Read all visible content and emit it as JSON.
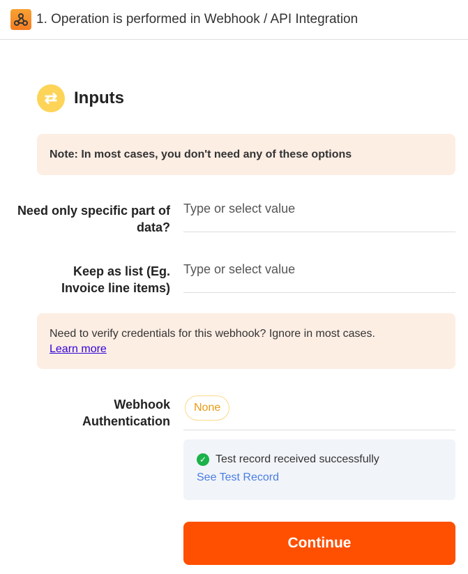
{
  "header": {
    "title": "1. Operation is performed in Webhook / API Integration",
    "icon": "webhook-icon"
  },
  "inputs": {
    "title": "Inputs",
    "icon": "swap-arrows-icon"
  },
  "note": "Note: In most cases, you don't need any of these options",
  "fields": [
    {
      "label": "Need only specific part of data?",
      "placeholder": "Type or select value"
    },
    {
      "label": "Keep as list (Eg. Invoice line items)",
      "placeholder": "Type or select value"
    }
  ],
  "credentials_note": {
    "text": "Need to verify credentials for this webhook? Ignore in most cases.",
    "link": "Learn more"
  },
  "auth": {
    "label": "Webhook Authentication",
    "value": "None"
  },
  "success": {
    "message": "Test record received successfully",
    "link": "See Test Record"
  },
  "continue_label": "Continue",
  "colors": {
    "accent": "#ff4f00",
    "success": "#1bb24a",
    "note_bg": "#fdeee4"
  }
}
